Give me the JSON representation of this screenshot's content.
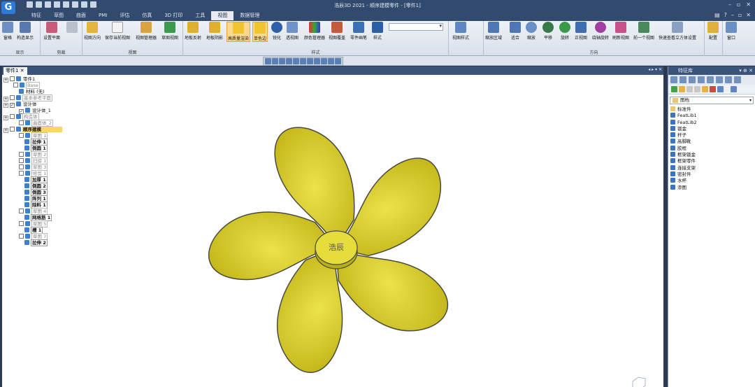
{
  "window": {
    "title": "浩辰3D 2021 - 顺序建模零件 - [零件1]",
    "logo": "G"
  },
  "tabs": [
    {
      "label": "特征"
    },
    {
      "label": "草图"
    },
    {
      "label": "曲面"
    },
    {
      "label": "PMI"
    },
    {
      "label": "评估"
    },
    {
      "label": "仿真"
    },
    {
      "label": "3D 打印"
    },
    {
      "label": "工具"
    },
    {
      "label": "视图"
    },
    {
      "label": "数据管理"
    }
  ],
  "ribbon": {
    "groups": [
      {
        "label": "显示"
      },
      {
        "label": "剪裁"
      },
      {
        "label": "视图"
      },
      {
        "label": "样式"
      },
      {
        "label": "方向"
      }
    ],
    "buttons": {
      "pane": "窗格",
      "construction": "构造显示",
      "clip_plane": "设置平面",
      "view_orient": "视图方向",
      "save_view": "保存当前视图",
      "view_manager": "视图管理器",
      "sketch_view": "草图视图",
      "floor_reflect": "地板反射",
      "floor_shadow": "地板阴影",
      "high_quality": "高质量渲染",
      "shade_edges": "单色边",
      "sharpen": "锐化",
      "transparent": "透视图",
      "color_manager": "颜色管理器",
      "view_overlay": "视图覆盖",
      "part_brush": "零件画笔",
      "style": "样式",
      "view_style": "视图样式",
      "zoom_area": "缩放区域",
      "fit": "适合",
      "zoom": "缩放",
      "pan": "平移",
      "rotate": "旋转",
      "normal_view": "正视图",
      "rotate_axis": "绕轴旋转",
      "refresh": "刷新视图",
      "prev_view": "前一个视图",
      "quick_cube": "快速查看立方体设置",
      "layout": "配置",
      "window": "窗口"
    }
  },
  "document": {
    "tab_label": "零件1"
  },
  "tree": [
    {
      "label": "零件1",
      "style": "normal"
    },
    {
      "label": "Base",
      "style": "grey"
    },
    {
      "label": "材料 (无)",
      "style": "normal"
    },
    {
      "label": "基本参考平面",
      "style": "grey"
    },
    {
      "label": "设计体",
      "style": "normal"
    },
    {
      "label": "设计体_1",
      "style": "normal"
    },
    {
      "label": "构造体",
      "style": "grey"
    },
    {
      "label": "曲面体_2",
      "style": "grey"
    },
    {
      "label": "顺序建模",
      "style": "hl"
    },
    {
      "label": "草图 1",
      "style": "grey"
    },
    {
      "label": "拉伸 1",
      "style": "bold"
    },
    {
      "label": "倒圆 1",
      "style": "bold"
    },
    {
      "label": "草图 2",
      "style": "grey"
    },
    {
      "label": "扫掠 1",
      "style": "grey"
    },
    {
      "label": "草图 3",
      "style": "grey"
    },
    {
      "label": "修剪 1",
      "style": "grey"
    },
    {
      "label": "加厚 1",
      "style": "bold"
    },
    {
      "label": "倒圆 2",
      "style": "bold"
    },
    {
      "label": "倒圆 3",
      "style": "bold"
    },
    {
      "label": "阵列 1",
      "style": "bold"
    },
    {
      "label": "除料 1",
      "style": "bold"
    },
    {
      "label": "草图 4",
      "style": "grey"
    },
    {
      "label": "网格筋 1",
      "style": "bold"
    },
    {
      "label": "草图 5",
      "style": "grey"
    },
    {
      "label": "槽 1",
      "style": "bold"
    },
    {
      "label": "草图 7",
      "style": "grey"
    },
    {
      "label": "拉伸 2",
      "style": "bold"
    }
  ],
  "model": {
    "hub_text": "浩辰",
    "blade_color": "#d9cc2a",
    "edge_color": "#4a4a40"
  },
  "right_panel": {
    "title": "特征库",
    "folder": "图档",
    "items": [
      "标准件",
      "FeatLib1",
      "FeatLib2",
      "钣金",
      "杆子",
      "高脚靴",
      "胶框",
      "框架钣金",
      "框架零件",
      "连接支架",
      "密封件",
      "水杯",
      "渗图"
    ]
  },
  "colors": {
    "titlebar": "#314a6e",
    "accent": "#fbd98b",
    "tree_highlight": "#fcd571"
  }
}
